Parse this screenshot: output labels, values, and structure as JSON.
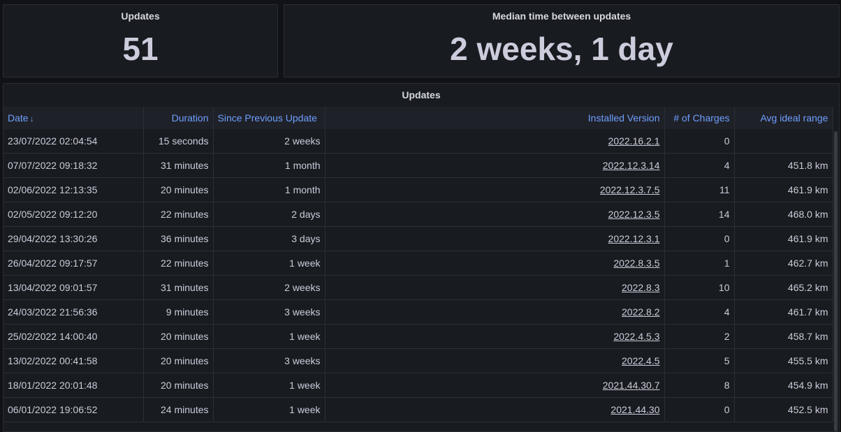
{
  "stats": {
    "count": {
      "title": "Updates",
      "value": "51"
    },
    "median": {
      "title": "Median time between updates",
      "value": "2 weeks, 1 day"
    }
  },
  "table": {
    "title": "Updates",
    "columns": [
      "Date",
      "Duration",
      "Since Previous Update",
      "Installed Version",
      "# of Charges",
      "Avg ideal range"
    ],
    "rows": [
      [
        "23/07/2022 02:04:54",
        "15 seconds",
        "2 weeks",
        "2022.16.2.1",
        "0",
        ""
      ],
      [
        "07/07/2022 09:18:32",
        "31 minutes",
        "1 month",
        "2022.12.3.14",
        "4",
        "451.8 km"
      ],
      [
        "02/06/2022 12:13:35",
        "20 minutes",
        "1 month",
        "2022.12.3.7.5",
        "11",
        "461.9 km"
      ],
      [
        "02/05/2022 09:12:20",
        "22 minutes",
        "2 days",
        "2022.12.3.5",
        "14",
        "468.0 km"
      ],
      [
        "29/04/2022 13:30:26",
        "36 minutes",
        "3 days",
        "2022.12.3.1",
        "0",
        "461.9 km"
      ],
      [
        "26/04/2022 09:17:57",
        "22 minutes",
        "1 week",
        "2022.8.3.5",
        "1",
        "462.7 km"
      ],
      [
        "13/04/2022 09:01:57",
        "31 minutes",
        "2 weeks",
        "2022.8.3",
        "10",
        "465.2 km"
      ],
      [
        "24/03/2022 21:56:36",
        "9 minutes",
        "3 weeks",
        "2022.8.2",
        "4",
        "461.7 km"
      ],
      [
        "25/02/2022 14:00:40",
        "20 minutes",
        "1 week",
        "2022.4.5.3",
        "2",
        "458.7 km"
      ],
      [
        "13/02/2022 00:41:58",
        "20 minutes",
        "3 weeks",
        "2022.4.5",
        "5",
        "455.5 km"
      ],
      [
        "18/01/2022 20:01:48",
        "20 minutes",
        "1 week",
        "2021.44.30.7",
        "8",
        "454.9 km"
      ],
      [
        "06/01/2022 19:06:52",
        "24 minutes",
        "1 week",
        "2021.44.30",
        "0",
        "452.5 km"
      ]
    ]
  },
  "icons": {
    "sort": "arrow-down-icon"
  },
  "colors": {
    "header_link": "#6e9fff",
    "background": "#111217",
    "panel": "#181b1f"
  }
}
